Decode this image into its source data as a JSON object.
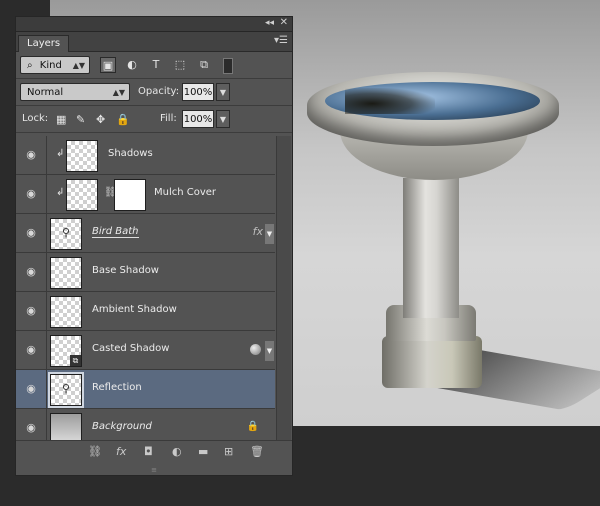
{
  "panel": {
    "tab_label": "Layers",
    "collapse_glyph": "◂◂",
    "close_glyph": "✕",
    "menu_glyph": "▾☰"
  },
  "filter": {
    "kind_label": "Kind",
    "search_glyph": "⌕",
    "icons": [
      "image-filter-icon",
      "adjustment-filter-icon",
      "type-filter-icon",
      "shape-filter-icon",
      "smart-object-filter-icon"
    ]
  },
  "blend": {
    "mode": "Normal",
    "opacity_label": "Opacity:",
    "opacity_value": "100%"
  },
  "lock": {
    "label": "Lock:",
    "fill_label": "Fill:",
    "fill_value": "100%"
  },
  "layers": [
    {
      "name": "Shadows",
      "clipped": true,
      "thumb": "transparent",
      "style": "normal",
      "selected": false
    },
    {
      "name": "Mulch Cover",
      "clipped": true,
      "thumb": "transparent",
      "mask": true,
      "style": "normal",
      "selected": false
    },
    {
      "name": "Bird Bath",
      "thumb": "transparent",
      "style": "underline",
      "fx": "fx",
      "selected": false
    },
    {
      "name": "Base Shadow",
      "thumb": "transparent",
      "style": "normal",
      "selected": false
    },
    {
      "name": "Ambient Shadow",
      "thumb": "transparent",
      "style": "normal",
      "selected": false
    },
    {
      "name": "Casted Shadow",
      "thumb": "transparent",
      "style": "normal",
      "smart_object": true,
      "selected": false
    },
    {
      "name": "Reflection",
      "thumb": "transparent",
      "style": "normal",
      "selected": true
    },
    {
      "name": "Background",
      "thumb": "gradient",
      "style": "italic",
      "locked": true,
      "selected": false
    }
  ],
  "glyphs": {
    "eye": "◉",
    "clip": "↲",
    "chain": "⛓",
    "lock": "🔒",
    "fx": "fx",
    "footer": [
      "⛓",
      "fx",
      "◘",
      "◐",
      "▬",
      "⊞",
      "🗑"
    ]
  }
}
